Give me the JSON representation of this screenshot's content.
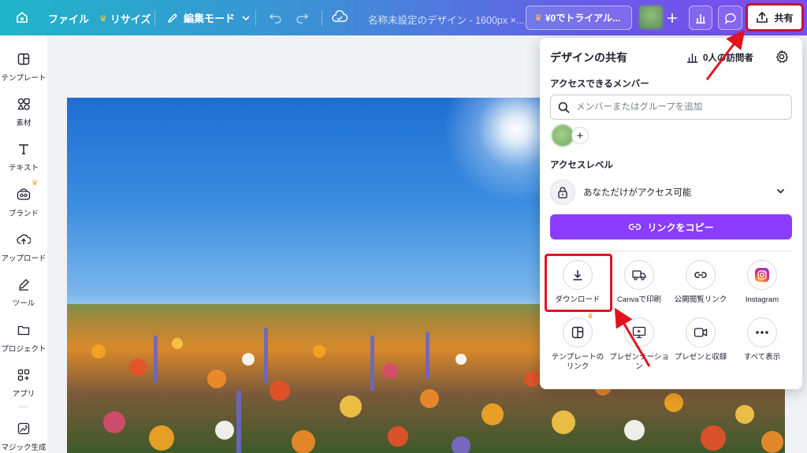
{
  "topbar": {
    "file": "ファイル",
    "resize": "リサイズ",
    "edit_mode": "編集モード",
    "doc_title": "名称未設定のデザイン - 1600px ×...",
    "trial": "¥0でトライアル...",
    "share": "共有"
  },
  "sidebar": {
    "items": [
      {
        "label": "テンプレート",
        "icon": "template-icon"
      },
      {
        "label": "素材",
        "icon": "elements-icon"
      },
      {
        "label": "テキスト",
        "icon": "text-icon"
      },
      {
        "label": "ブランド",
        "icon": "brand-icon"
      },
      {
        "label": "アップロード",
        "icon": "upload-icon"
      },
      {
        "label": "ツール",
        "icon": "tools-icon"
      },
      {
        "label": "プロジェクト",
        "icon": "folder-icon"
      },
      {
        "label": "アプリ",
        "icon": "apps-icon"
      },
      {
        "label": "マジック生成",
        "icon": "magic-media-icon"
      }
    ]
  },
  "share_panel": {
    "title": "デザインの共有",
    "visitors": "0人の訪問者",
    "members_heading": "アクセスできるメンバー",
    "search_placeholder": "メンバーまたはグループを追加",
    "access_heading": "アクセスレベル",
    "access_value": "あなただけがアクセス可能",
    "copy_link": "リンクをコピー",
    "options": [
      {
        "label": "ダウンロード",
        "icon": "download-icon"
      },
      {
        "label": "Canvaで印刷",
        "icon": "truck-icon"
      },
      {
        "label": "公開閲覧リンク",
        "icon": "link-icon"
      },
      {
        "label": "Instagram",
        "icon": "instagram-icon"
      },
      {
        "label": "テンプレートの\nリンク",
        "icon": "template-link-icon"
      },
      {
        "label": "プレゼンテーション",
        "icon": "present-icon"
      },
      {
        "label": "プレゼンと収録",
        "icon": "record-icon"
      },
      {
        "label": "すべて表示",
        "icon": "more-icon"
      }
    ]
  },
  "colors": {
    "accent": "#8b3dff",
    "highlight": "#e2131e"
  }
}
